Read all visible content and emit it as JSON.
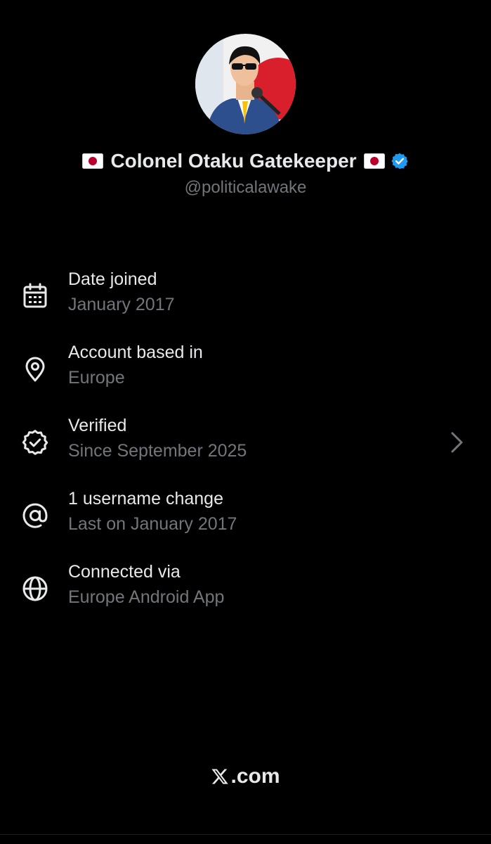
{
  "profile": {
    "display_name": "Colonel Otaku Gatekeeper",
    "handle": "@politicalawake",
    "avatar_icon": "avatar-man-sunglasses-microphone-japan-flag",
    "leading_flag_icon": "japan-flag-icon",
    "trailing_flag_icon": "japan-flag-icon",
    "verified_badge_icon": "verified-badge-icon",
    "verified_badge_color": "#1d9bf0"
  },
  "about_items": [
    {
      "icon": "calendar-icon",
      "title": "Date joined",
      "subtitle": "January 2017"
    },
    {
      "icon": "location-pin-icon",
      "title": "Account based in",
      "subtitle": "Europe"
    },
    {
      "icon": "verified-check-icon",
      "title": "Verified",
      "subtitle": "Since September 2025",
      "chevron_icon": "chevron-right-icon"
    },
    {
      "icon": "at-sign-icon",
      "title": "1 username change",
      "subtitle": "Last on January 2017"
    },
    {
      "icon": "globe-icon",
      "title": "Connected via",
      "subtitle": "Europe Android App"
    }
  ],
  "footer": {
    "logo_icon": "x-logo-icon",
    "text": ".com"
  },
  "colors": {
    "background": "#000000",
    "primary_text": "#e7e9ea",
    "secondary_text": "#71767b",
    "accent": "#1d9bf0",
    "flag_red": "#bc002d"
  }
}
